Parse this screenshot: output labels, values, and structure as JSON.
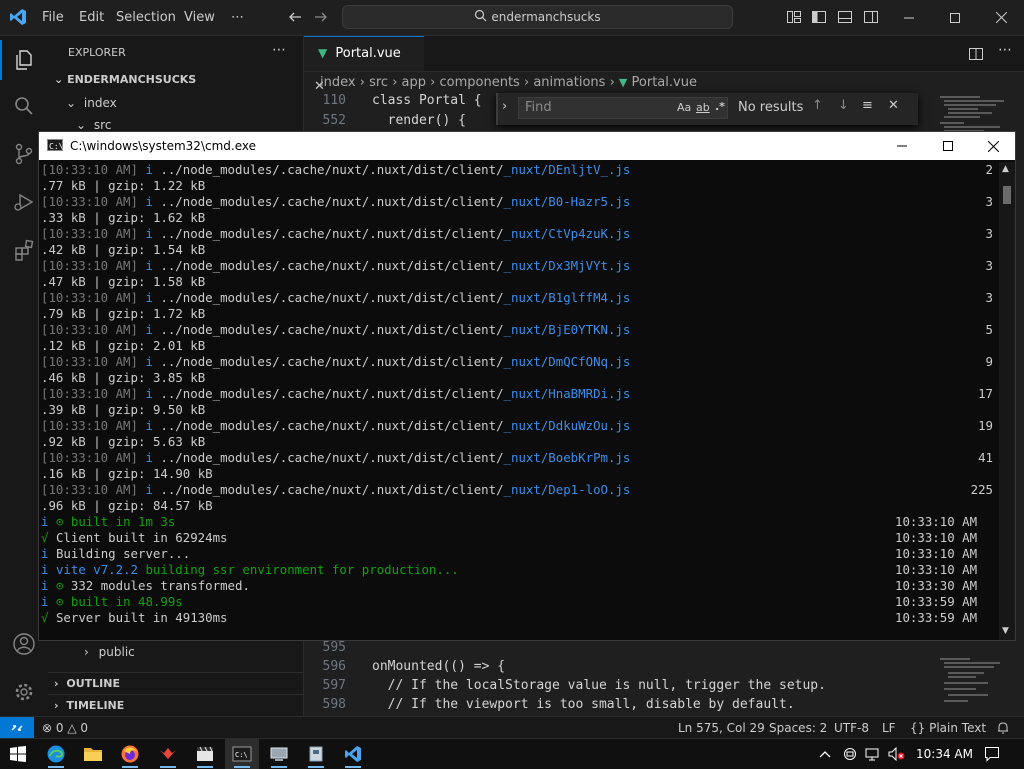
{
  "titlebar": {
    "menus": [
      "File",
      "Edit",
      "Selection",
      "View",
      "⋯"
    ],
    "search_text": "endermanchsucks"
  },
  "sidebar": {
    "header": "EXPLORER",
    "more": "⋯",
    "workspace": "ENDERMANCHSUCKS",
    "tree": [
      "index",
      "src"
    ],
    "public_item": "public",
    "outline": "OUTLINE",
    "timeline": "TIMELINE"
  },
  "editor": {
    "tab_label": "Portal.vue",
    "breadcrumbs": [
      "index",
      "src",
      "app",
      "components",
      "animations",
      "Portal.vue"
    ],
    "find": {
      "placeholder": "Find",
      "opt_case": "Aa",
      "opt_word": "ab",
      "opt_regex": ".*",
      "result": "No results"
    },
    "top_lines": [
      {
        "num": "110",
        "code": "class Portal {"
      },
      {
        "num": "552",
        "code": "  render() {"
      }
    ],
    "bottom_lines": [
      {
        "num": "595",
        "code": ""
      },
      {
        "num": "596",
        "code": "onMounted(() => {"
      },
      {
        "num": "597",
        "code": "  // If the localStorage value is null, trigger the setup."
      },
      {
        "num": "598",
        "code": "  // If the viewport is too small, disable by default."
      }
    ]
  },
  "statusbar": {
    "problems": "0",
    "warnings": "0",
    "position": "Ln 575, Col 29",
    "spaces": "Spaces: 2",
    "encoding": "UTF-8",
    "eol": "LF",
    "language": "Plain Text",
    "language_icon": "{}"
  },
  "cmd": {
    "title": "C:\\windows\\system32\\cmd.exe",
    "files": [
      {
        "ts": "[10:33:10 AM]",
        "i": "i",
        "path": "../node_modules/.cache/nuxt/.nuxt/dist/client/",
        "file": "_nuxt/DEnljtV_.js",
        "size_lead": "2",
        "size_rest": ".77 kB",
        "gzip": "1.22 kB"
      },
      {
        "ts": "[10:33:10 AM]",
        "i": "i",
        "path": "../node_modules/.cache/nuxt/.nuxt/dist/client/",
        "file": "_nuxt/B0-Hazr5.js",
        "size_lead": "3",
        "size_rest": ".33 kB",
        "gzip": "1.62 kB"
      },
      {
        "ts": "[10:33:10 AM]",
        "i": "i",
        "path": "../node_modules/.cache/nuxt/.nuxt/dist/client/",
        "file": "_nuxt/CtVp4zuK.js",
        "size_lead": "3",
        "size_rest": ".42 kB",
        "gzip": "1.54 kB"
      },
      {
        "ts": "[10:33:10 AM]",
        "i": "i",
        "path": "../node_modules/.cache/nuxt/.nuxt/dist/client/",
        "file": "_nuxt/Dx3MjVYt.js",
        "size_lead": "3",
        "size_rest": ".47 kB",
        "gzip": "1.58 kB"
      },
      {
        "ts": "[10:33:10 AM]",
        "i": "i",
        "path": "../node_modules/.cache/nuxt/.nuxt/dist/client/",
        "file": "_nuxt/B1glffM4.js",
        "size_lead": "3",
        "size_rest": ".79 kB",
        "gzip": "1.72 kB"
      },
      {
        "ts": "[10:33:10 AM]",
        "i": "i",
        "path": "../node_modules/.cache/nuxt/.nuxt/dist/client/",
        "file": "_nuxt/BjE0YTKN.js",
        "size_lead": "5",
        "size_rest": ".12 kB",
        "gzip": "2.01 kB"
      },
      {
        "ts": "[10:33:10 AM]",
        "i": "i",
        "path": "../node_modules/.cache/nuxt/.nuxt/dist/client/",
        "file": "_nuxt/DmQCfONq.js",
        "size_lead": "9",
        "size_rest": ".46 kB",
        "gzip": "3.85 kB"
      },
      {
        "ts": "[10:33:10 AM]",
        "i": "i",
        "path": "../node_modules/.cache/nuxt/.nuxt/dist/client/",
        "file": "_nuxt/HnaBMRDi.js",
        "size_lead": "17",
        "size_rest": ".39 kB",
        "gzip": "9.50 kB"
      },
      {
        "ts": "[10:33:10 AM]",
        "i": "i",
        "path": "../node_modules/.cache/nuxt/.nuxt/dist/client/",
        "file": "_nuxt/DdkuWzOu.js",
        "size_lead": "19",
        "size_rest": ".92 kB",
        "gzip": "5.63 kB"
      },
      {
        "ts": "[10:33:10 AM]",
        "i": "i",
        "path": "../node_modules/.cache/nuxt/.nuxt/dist/client/",
        "file": "_nuxt/BoebKrPm.js",
        "size_lead": "41",
        "size_rest": ".16 kB",
        "gzip": "14.90 kB"
      },
      {
        "ts": "[10:33:10 AM]",
        "i": "i",
        "path": "../node_modules/.cache/nuxt/.nuxt/dist/client/",
        "file": "_nuxt/Dep1-loO.js",
        "size_lead": "225",
        "size_rest": ".96 kB",
        "gzip": "84.57 kB"
      }
    ],
    "gzip_label": "gzip:",
    "log": [
      {
        "prefix": "i",
        "glyph": "⊙",
        "text": "built in 1m 3s",
        "style": "grn",
        "time": "10:33:10 AM"
      },
      {
        "prefix": "√",
        "glyph": "",
        "text": "Client built in 62924ms",
        "style": "plain",
        "time": "10:33:10 AM"
      },
      {
        "prefix": "i",
        "glyph": "",
        "text": "Building server...",
        "style": "plain",
        "time": "10:33:10 AM"
      },
      {
        "prefix": "i",
        "glyph": "",
        "text": "vite v7.2.2 building ssr environment for production...",
        "style": "mixed",
        "time": "10:33:10 AM"
      },
      {
        "prefix": "i",
        "glyph": "⊙",
        "text": "332 modules transformed.",
        "style": "plain",
        "time": "10:33:30 AM"
      },
      {
        "prefix": "i",
        "glyph": "⊙",
        "text": "built in 48.99s",
        "style": "grn",
        "time": "10:33:59 AM"
      },
      {
        "prefix": "√",
        "glyph": "",
        "text": "Server built in 49130ms",
        "style": "plain",
        "time": "10:33:59 AM"
      }
    ]
  },
  "taskbar": {
    "clock": "10:34 AM"
  },
  "colors": {
    "accent": "#0078d4",
    "vue_green": "#41b883",
    "link_blue": "#3b8eea",
    "success_green": "#13a10e"
  }
}
